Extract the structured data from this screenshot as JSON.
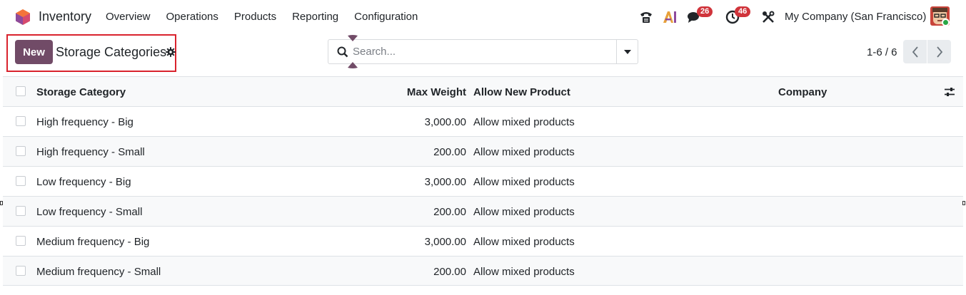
{
  "app": {
    "name": "Inventory",
    "logo_icon": "odoo-inventory-logo-icon",
    "menu": [
      "Overview",
      "Operations",
      "Products",
      "Reporting",
      "Configuration"
    ]
  },
  "systray": {
    "phone_icon": "phone-icon",
    "ai_icon": "ai-icon",
    "messages_icon": "chat-icon",
    "messages_count": "26",
    "activities_icon": "clock-icon",
    "activities_count": "46",
    "debug_icon": "tools-icon",
    "company": "My Company (San Francisco)",
    "avatar_icon": "user-avatar"
  },
  "control_panel": {
    "new_label": "New",
    "title": "Storage Categories",
    "search_placeholder": "Search...",
    "pager": "1-6 / 6"
  },
  "list": {
    "columns": {
      "name": "Storage Category",
      "max_weight": "Max Weight",
      "allow_new_product": "Allow New Product",
      "company": "Company"
    },
    "rows": [
      {
        "name": "High frequency - Big",
        "max_weight": "3,000.00",
        "allow_new_product": "Allow mixed products",
        "company": ""
      },
      {
        "name": "High frequency - Small",
        "max_weight": "200.00",
        "allow_new_product": "Allow mixed products",
        "company": ""
      },
      {
        "name": "Low frequency - Big",
        "max_weight": "3,000.00",
        "allow_new_product": "Allow mixed products",
        "company": ""
      },
      {
        "name": "Low frequency - Small",
        "max_weight": "200.00",
        "allow_new_product": "Allow mixed products",
        "company": ""
      },
      {
        "name": "Medium frequency - Big",
        "max_weight": "3,000.00",
        "allow_new_product": "Allow mixed products",
        "company": ""
      },
      {
        "name": "Medium frequency - Small",
        "max_weight": "200.00",
        "allow_new_product": "Allow mixed products",
        "company": ""
      }
    ]
  },
  "colors": {
    "brand": "#714b67",
    "badge": "#d0343b",
    "highlight": "#d9232d",
    "online": "#28a745"
  }
}
